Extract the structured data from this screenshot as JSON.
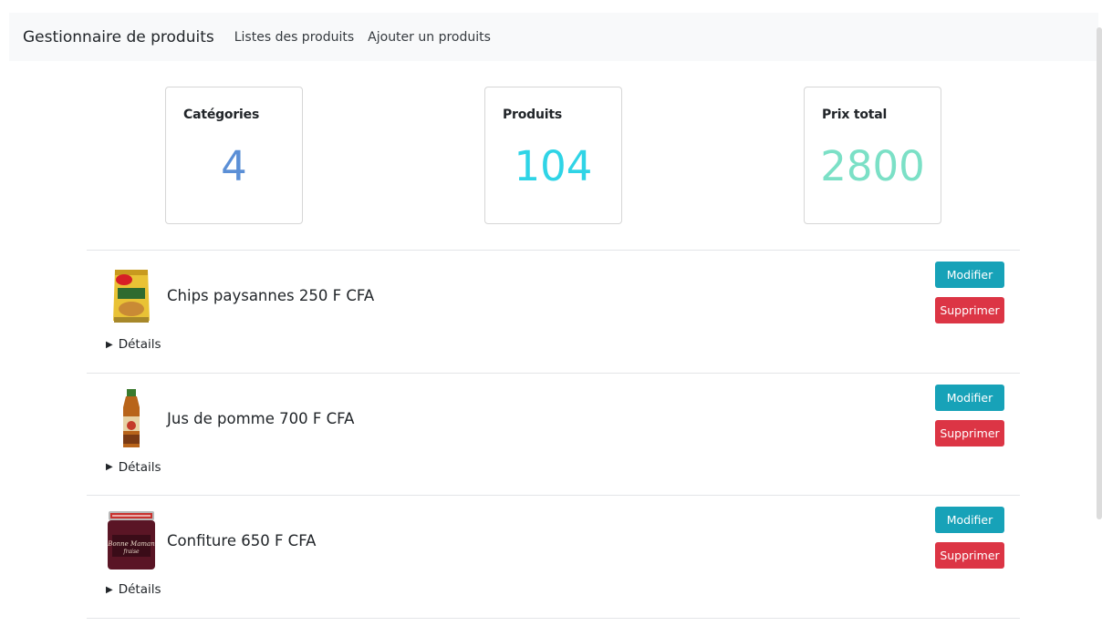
{
  "navbar": {
    "brand": "Gestionnaire de produits",
    "links": [
      "Listes des produits",
      "Ajouter un produits"
    ]
  },
  "stats": [
    {
      "title": "Catégories",
      "value": "4",
      "color": "#5b8fd6"
    },
    {
      "title": "Produits",
      "value": "104",
      "color": "#2fd4e6"
    },
    {
      "title": "Prix total",
      "value": "2800",
      "color": "#7be0c6"
    }
  ],
  "products": [
    {
      "name": "Chips paysannes 250 F CFA",
      "image_icon": "chips-bag-icon",
      "details_label": "Détails",
      "edit_label": "Modifier",
      "delete_label": "Supprimer"
    },
    {
      "name": "Jus de pomme 700 F CFA",
      "image_icon": "juice-bottle-icon",
      "details_label": "Détails",
      "edit_label": "Modifier",
      "delete_label": "Supprimer"
    },
    {
      "name": "Confiture 650 F CFA",
      "image_icon": "jam-jar-icon",
      "details_label": "Détails",
      "edit_label": "Modifier",
      "delete_label": "Supprimer"
    }
  ],
  "colors": {
    "edit_button": "#17a2b8",
    "delete_button": "#dc3545",
    "navbar_bg": "#f8f9fa"
  }
}
